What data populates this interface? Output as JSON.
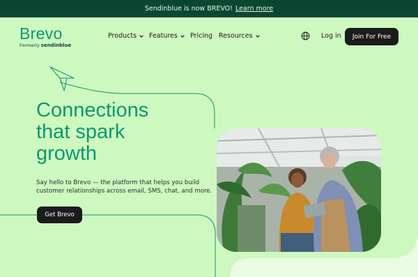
{
  "announcement": {
    "text": "Sendinblue is now BREVO!",
    "link": "Learn more"
  },
  "logo": {
    "name": "Brevo",
    "formerly": "Formerly",
    "old_name": "sendinblue"
  },
  "nav": {
    "items": [
      {
        "label": "Products",
        "has_menu": true
      },
      {
        "label": "Features",
        "has_menu": true
      },
      {
        "label": "Pricing",
        "has_menu": false
      },
      {
        "label": "Resources",
        "has_menu": true
      }
    ],
    "language_icon": "globe-icon",
    "login": "Log in",
    "join": "Join For Free"
  },
  "hero": {
    "headline": [
      "Connections",
      "that spark",
      "growth"
    ],
    "subtitle": "Say hello to Brevo — the platform that helps you build customer relationships across email, SMS, chat, and more.",
    "cta": "Get Brevo",
    "image_alt": "two-women-with-tablet-in-plant-shop"
  },
  "colors": {
    "background": "#cdf8c0",
    "announcement_bg": "#0a4733",
    "brand_green": "#0b996e",
    "dark_button": "#1b1b1b"
  }
}
